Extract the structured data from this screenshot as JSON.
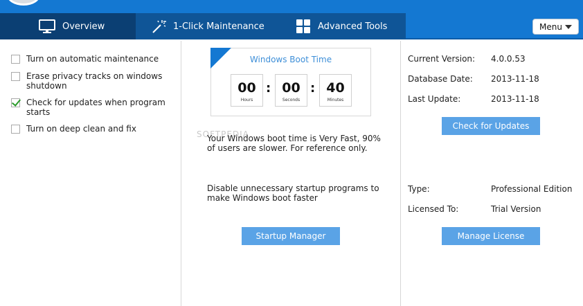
{
  "tabs": [
    {
      "label": "Overview",
      "icon": "monitor-icon"
    },
    {
      "label": "1-Click Maintenance",
      "icon": "magic-wand-icon"
    },
    {
      "label": "Advanced Tools",
      "icon": "grid-icon"
    }
  ],
  "menu": {
    "label": "Menu"
  },
  "options": [
    {
      "label": "Turn on automatic maintenance",
      "checked": false
    },
    {
      "label": "Erase privacy tracks on windows shutdown",
      "checked": false
    },
    {
      "label": "Check for updates when program starts",
      "checked": true
    },
    {
      "label": "Turn on deep clean and fix",
      "checked": false
    }
  ],
  "boot": {
    "title": "Windows Boot Time",
    "hours": "00",
    "hours_label": "Hours",
    "seconds": "00",
    "seconds_label": "Seconds",
    "minutes": "40",
    "minutes_label": "Minutes",
    "separator": ":"
  },
  "watermark": "SOFTPEDIA",
  "boot_message": "Your Windows boot time is Very Fast, 90% of users are slower. For reference only.",
  "startup_tip": "Disable unnecessary startup programs to make Windows boot faster",
  "startup_button": "Startup Manager",
  "info": {
    "current_version_label": "Current Version:",
    "current_version": "4.0.0.53",
    "database_date_label": "Database Date:",
    "database_date": "2013-11-18",
    "last_update_label": "Last Update:",
    "last_update": "2013-11-18",
    "check_button": "Check for Updates",
    "type_label": "Type:",
    "type": "Professional Edition",
    "licensed_label": "Licensed To:",
    "licensed": "Trial Version",
    "license_button": "Manage License"
  },
  "colors": {
    "accent": "#1478d2",
    "button": "#5aa3e6",
    "active_tab": "#0b3f73"
  }
}
